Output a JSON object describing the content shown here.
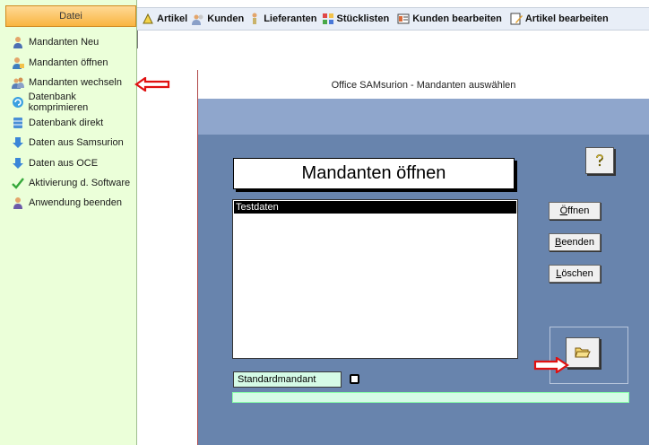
{
  "sidebar": {
    "header": "Datei",
    "items": [
      {
        "label": "Mandanten Neu",
        "icon": "person-icon"
      },
      {
        "label": "Mandanten öffnen",
        "icon": "person-open-icon"
      },
      {
        "label": "Mandanten wechseln",
        "icon": "person-switch-icon"
      },
      {
        "label": "Datenbank komprimieren",
        "icon": "compress-icon"
      },
      {
        "label": "Datenbank direkt",
        "icon": "database-icon"
      },
      {
        "label": "Daten aus Samsurion",
        "icon": "arrow-down-icon"
      },
      {
        "label": "Daten aus OCE",
        "icon": "arrow-down-icon"
      },
      {
        "label": "Aktivierung d. Software",
        "icon": "checkmark-icon"
      },
      {
        "label": "Anwendung beenden",
        "icon": "person-exit-icon"
      }
    ]
  },
  "toolbar": {
    "items": [
      {
        "label": "Artikel",
        "icon": "article-icon"
      },
      {
        "label": "Kunden",
        "icon": "customers-icon"
      },
      {
        "label": "Lieferanten",
        "icon": "supplier-icon"
      },
      {
        "label": "Stücklisten",
        "icon": "parts-list-icon"
      },
      {
        "label": "Kunden bearbeiten",
        "icon": "edit-customers-icon"
      },
      {
        "label": "Artikel bearbeiten",
        "icon": "edit-article-icon"
      }
    ]
  },
  "dialog": {
    "title": "Office SAMsurion - Mandanten auswählen",
    "heading": "Mandanten öffnen",
    "list_items": [
      "Testdaten"
    ],
    "buttons": {
      "open": {
        "mnemonic": "Ö",
        "rest": "ffnen"
      },
      "exit": {
        "mnemonic": "B",
        "rest": "eenden"
      },
      "delete": {
        "mnemonic": "L",
        "rest": "öschen"
      }
    },
    "default_client_label": "Standardmandant",
    "help_icon": "question-icon",
    "open_folder_icon": "open-folder-icon"
  },
  "colors": {
    "sidebar_bg": "#ebffd9",
    "dialog_bg": "#6884ad",
    "accent_arrow": "#e01010",
    "field_bg": "#d5fbe6"
  }
}
